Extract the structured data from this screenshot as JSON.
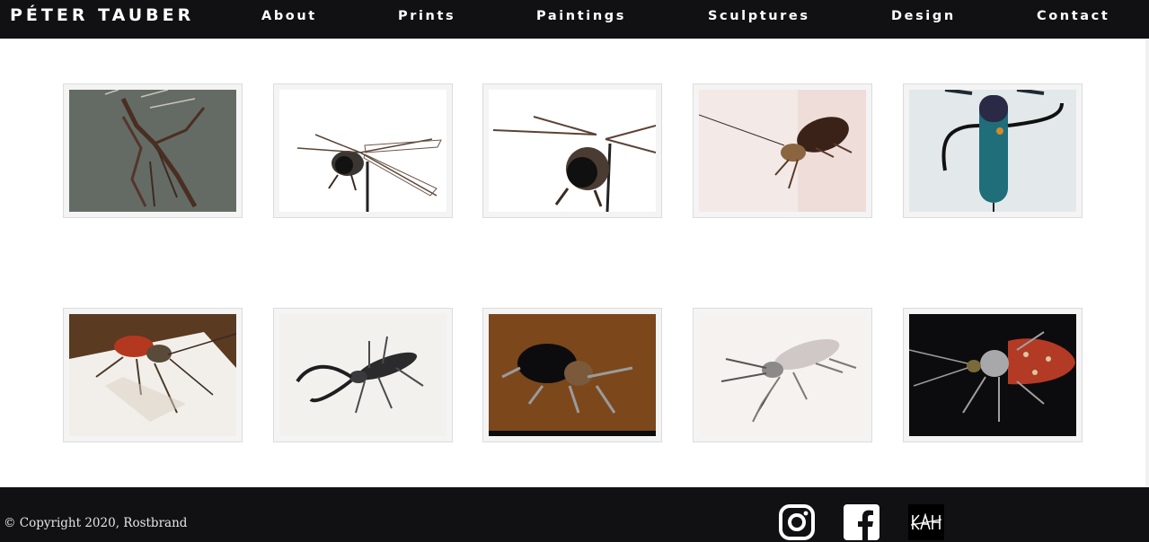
{
  "header": {
    "brand": "PÉTER TAUBER",
    "nav": [
      "About",
      "Prints",
      "Paintings",
      "Sculptures",
      "Design",
      "Contact"
    ]
  },
  "gallery": {
    "items": [
      {
        "icon": "bird-sculpture-image"
      },
      {
        "icon": "dragonfly-sculpture-image"
      },
      {
        "icon": "dragonfly-closeup-sculpture-image"
      },
      {
        "icon": "cricket-sculpture-image"
      },
      {
        "icon": "hanging-insect-sculpture-image"
      },
      {
        "icon": "red-beetle-sculpture-image"
      },
      {
        "icon": "stag-beetle-sculpture-image"
      },
      {
        "icon": "black-beetle-sculpture-image"
      },
      {
        "icon": "silver-beetle-sculpture-image"
      },
      {
        "icon": "red-ladybug-sculpture-image"
      }
    ]
  },
  "footer": {
    "copyright": "© Copyright 2020, Rostbrand",
    "social": [
      {
        "icon": "instagram-icon"
      },
      {
        "icon": "facebook-icon"
      },
      {
        "icon": "kah-logo-icon",
        "logo_text": "KAH"
      }
    ]
  },
  "colors": {
    "bar": "#111113",
    "text_light": "#ffffff",
    "thumb_border": "#dcdcdc"
  }
}
